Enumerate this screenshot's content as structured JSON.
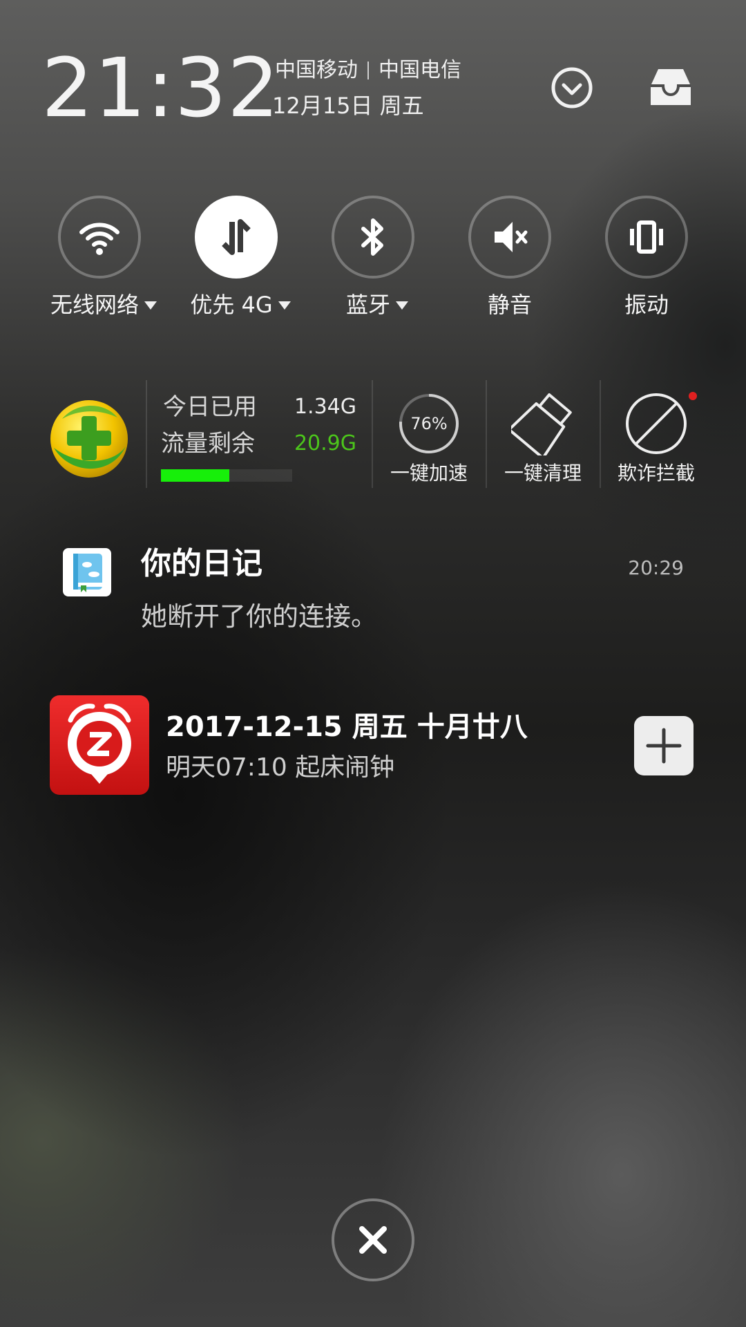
{
  "header": {
    "time": "21:32",
    "carrier_1": "中国移动",
    "carrier_2": "中国电信",
    "date": "12月15日 周五"
  },
  "toggles": [
    {
      "label": "无线网络",
      "icon": "wifi-icon",
      "active": false,
      "has_dropdown": true
    },
    {
      "label": "优先 4G",
      "icon": "mobile-data-icon",
      "active": true,
      "has_dropdown": true
    },
    {
      "label": "蓝牙",
      "icon": "bluetooth-icon",
      "active": false,
      "has_dropdown": true
    },
    {
      "label": "静音",
      "icon": "mute-icon",
      "active": false,
      "has_dropdown": false
    },
    {
      "label": "振动",
      "icon": "vibrate-icon",
      "active": false,
      "has_dropdown": false
    }
  ],
  "security_widget": {
    "used_label": "今日已用",
    "used_value": "1.34G",
    "remaining_label": "流量剩余",
    "remaining_value": "20.9G",
    "remaining_color": "#4cc61b",
    "progress_fraction": 0.52,
    "progress_color": "#17ef0a",
    "boost_percent": "76%",
    "boost_level": 0.76,
    "boost_label": "一键加速",
    "clean_label": "一键清理",
    "fraud_label": "欺诈拦截",
    "fraud_badge_color": "#e02020"
  },
  "notifications": [
    {
      "app_icon": "diary-app-icon",
      "title": "你的日记",
      "text": "她断开了你的连接。",
      "time": "20:29"
    }
  ],
  "calendar_card": {
    "app_icon": "alarm-clock-app-icon",
    "title": "2017-12-15 周五 十月廿八",
    "text": "明天07:10 起床闹钟",
    "add_icon": "plus-icon"
  },
  "footer": {
    "clear_icon": "close-icon"
  },
  "colors": {
    "accent_white": "#ffffff",
    "alarm_red": "#d91c1c"
  }
}
